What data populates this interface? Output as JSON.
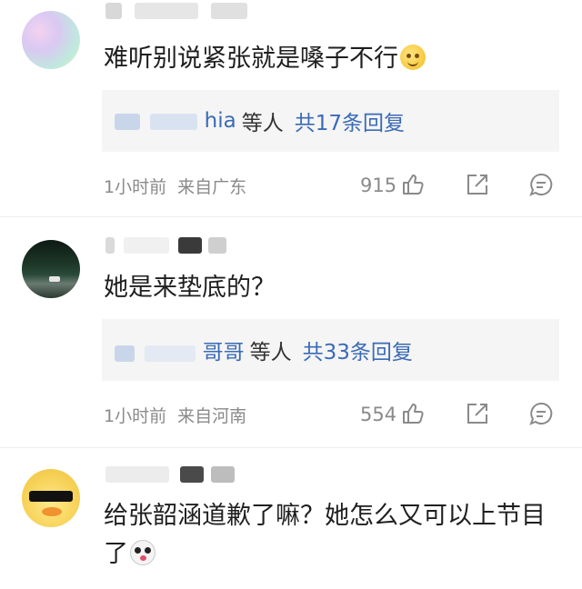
{
  "comments": [
    {
      "username": "T·心 叫·  ·  ·  · 1",
      "text": "难听别说紧张就是嗓子不行",
      "emoji": "smiling-face-emoji",
      "reply_names": "小··ia",
      "reply_names_visible": "ɑ  ₍ⅎ  hia",
      "reply_suffix": "等人",
      "reply_count": "共17条回复",
      "time": "1小时前",
      "location": "来自广东",
      "likes": "915"
    },
    {
      "username": "'                  ou",
      "text": "她是来垫底的？",
      "reply_names_visible": "周               哥哥",
      "reply_suffix": "等人",
      "reply_count": "共33条回复",
      "time": "1小时前",
      "location": "来自河南",
      "likes": "554"
    },
    {
      "username": "                  ·沉啊",
      "text": "给张韶涵道歉了嘛？她怎么又可以上节目了",
      "emoji": "panda-face-emoji"
    }
  ],
  "colors": {
    "link": "#3a6bb5",
    "meta": "#8a8a8a",
    "reply_bg": "#f5f5f5"
  }
}
